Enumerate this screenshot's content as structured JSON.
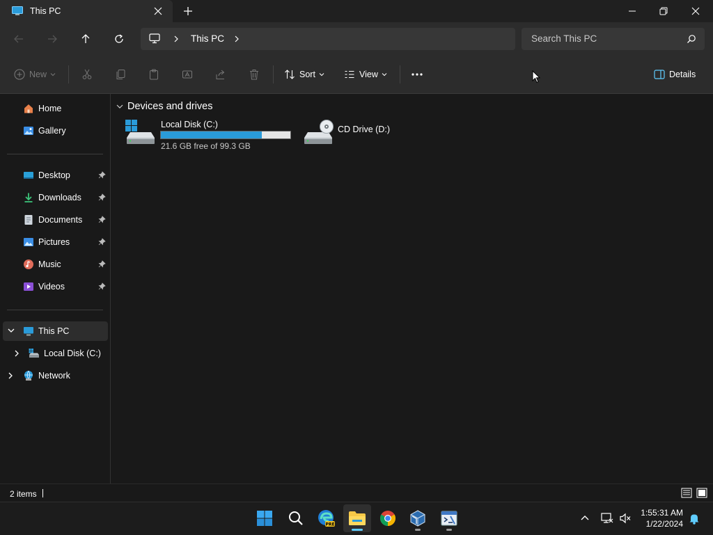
{
  "window": {
    "tab_title": "This PC",
    "colors": {
      "accent": "#60cdff",
      "usage_bar": "#2a9bd9",
      "background": "#191919",
      "chrome": "#2c2c2c"
    }
  },
  "address": {
    "crumb": "This PC",
    "search_placeholder": "Search This PC"
  },
  "toolbar": {
    "new_label": "New",
    "sort_label": "Sort",
    "view_label": "View",
    "details_label": "Details",
    "icons": [
      "cut-icon",
      "copy-icon",
      "paste-icon",
      "rename-icon",
      "share-icon",
      "delete-icon",
      "more-icon"
    ]
  },
  "sidebar": {
    "top": [
      {
        "label": "Home",
        "icon": "home-icon"
      },
      {
        "label": "Gallery",
        "icon": "gallery-icon"
      }
    ],
    "pinned": [
      {
        "label": "Desktop",
        "icon": "desktop-icon"
      },
      {
        "label": "Downloads",
        "icon": "downloads-icon"
      },
      {
        "label": "Documents",
        "icon": "documents-icon"
      },
      {
        "label": "Pictures",
        "icon": "pictures-icon"
      },
      {
        "label": "Music",
        "icon": "music-icon"
      },
      {
        "label": "Videos",
        "icon": "videos-icon"
      }
    ],
    "tree": {
      "this_pc": "This PC",
      "local_disk": "Local Disk (C:)",
      "network": "Network"
    }
  },
  "content": {
    "group_title": "Devices and drives",
    "drives": [
      {
        "name": "Local Disk (C:)",
        "space": "21.6 GB free of 99.3 GB",
        "used_fraction": 0.78
      },
      {
        "name": "CD Drive (D:)"
      }
    ]
  },
  "status": {
    "item_count": "2 items"
  },
  "taskbar": {
    "apps": [
      "start-icon",
      "search-icon",
      "edge-beta-icon",
      "file-explorer-icon",
      "chrome-icon",
      "virtualbox-icon",
      "cmd-tool-icon"
    ],
    "time": "1:55:31 AM",
    "date": "1/22/2024"
  }
}
